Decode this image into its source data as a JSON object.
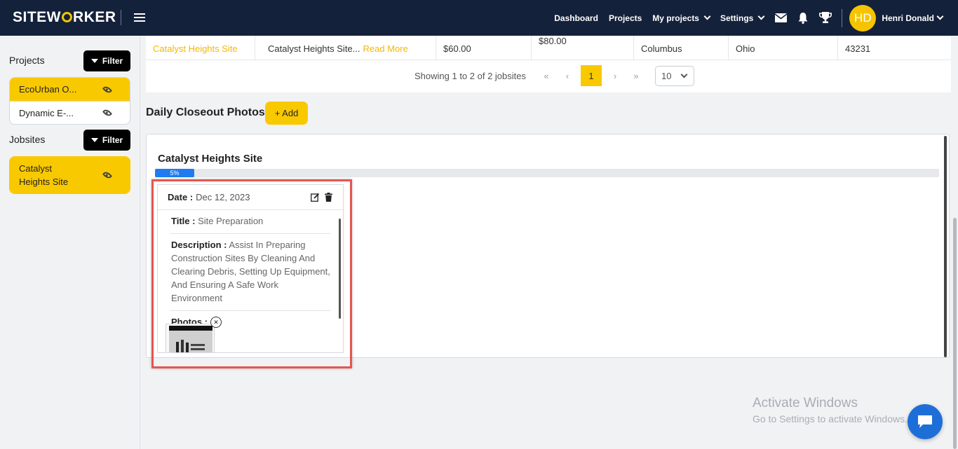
{
  "app": {
    "logo_text_pre": "SITEW",
    "logo_text_post": "RKER"
  },
  "nav": {
    "links": [
      "Dashboard",
      "Projects",
      "My projects",
      "Settings"
    ],
    "user_initials": "HD",
    "user_name": "Henri Donald"
  },
  "sidebar": {
    "projects_heading": "Projects",
    "jobsites_heading": "Jobsites",
    "filter_label": "Filter",
    "projects": [
      {
        "label": "EcoUrban O...",
        "active": true
      },
      {
        "label": "Dynamic E-...",
        "active": false
      }
    ],
    "jobsites": [
      {
        "label": "Catalyst Heights Site",
        "active": true
      }
    ]
  },
  "table": {
    "row": {
      "name": "Catalyst Heights Site",
      "description": "Catalyst Heights Site...",
      "read_more": "Read More",
      "amount1": "$60.00",
      "amount2": "$80.00",
      "city": "Columbus",
      "state": "Ohio",
      "zip": "43231"
    },
    "pagination": {
      "summary": "Showing 1 to 2 of 2 jobsites",
      "current_page": "1",
      "page_size": "10"
    }
  },
  "closeout": {
    "section_title": "Daily Closeout Photos",
    "add_label": "+ Add",
    "site_name": "Catalyst Heights Site",
    "progress_label": "5%",
    "progress_percent": 5,
    "entry": {
      "date_label": "Date :",
      "date_value": "Dec 12, 2023",
      "title_label": "Title :",
      "title_value": "Site Preparation",
      "description_label": "Description :",
      "description_value": "Assist In Preparing Construction Sites By Cleaning And Clearing Debris, Setting Up Equipment, And Ensuring A Safe Work Environment",
      "photos_label": "Photos :"
    }
  },
  "watermark": {
    "title": "Activate Windows",
    "subtitle": "Go to Settings to activate Windows."
  }
}
